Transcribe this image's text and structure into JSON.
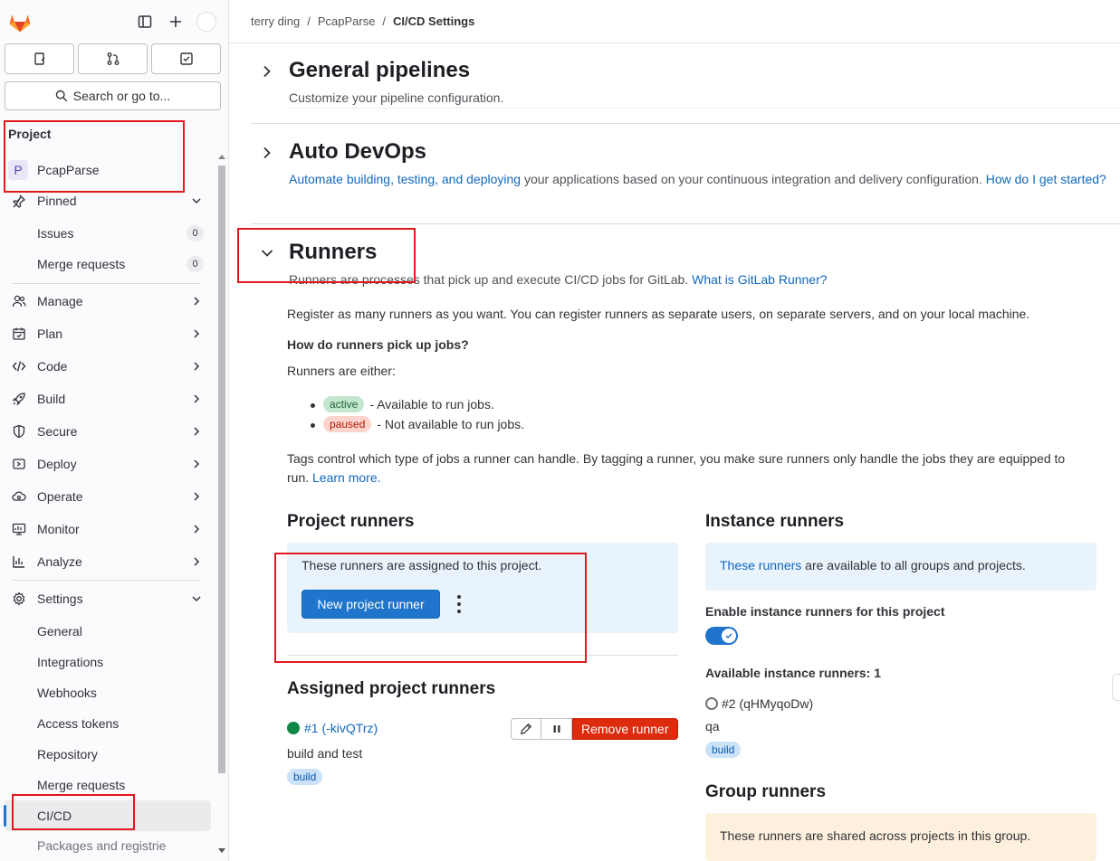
{
  "breadcrumb": {
    "items": [
      "terry ding",
      "PcapParse"
    ],
    "current": "CI/CD Settings"
  },
  "sidebar": {
    "search_label": "Search or go to...",
    "section_label": "Project",
    "project_initial": "P",
    "project_name": "PcapParse",
    "pinned_label": "Pinned",
    "pinned_items": [
      {
        "label": "Issues",
        "count": "0"
      },
      {
        "label": "Merge requests",
        "count": "0"
      }
    ],
    "nav": [
      "Manage",
      "Plan",
      "Code",
      "Build",
      "Secure",
      "Deploy",
      "Operate",
      "Monitor",
      "Analyze"
    ],
    "settings_label": "Settings",
    "settings_items": [
      "General",
      "Integrations",
      "Webhooks",
      "Access tokens",
      "Repository",
      "Merge requests",
      "CI/CD",
      "Packages and registrie"
    ]
  },
  "sections": {
    "general": {
      "title": "General pipelines",
      "desc": "Customize your pipeline configuration."
    },
    "autodevops": {
      "title": "Auto DevOps",
      "desc_link": "Automate building, testing, and deploying",
      "desc_text": " your applications based on your continuous integration and delivery configuration. ",
      "desc_link2": "How do I get started?"
    },
    "runners": {
      "title": "Runners",
      "desc_text": "Runners are processes that pick up and execute CI/CD jobs for GitLab. ",
      "desc_link": "What is GitLab Runner?",
      "register_text": "Register as many runners as you want. You can register runners as separate users, on separate servers, and on your local machine.",
      "how_heading": "How do runners pick up jobs?",
      "either_text": "Runners are either:",
      "active_pill": "active",
      "active_text": "- Available to run jobs.",
      "paused_pill": "paused",
      "paused_text": "- Not available to run jobs.",
      "tags_text": "Tags control which type of jobs a runner can handle. By tagging a runner, you make sure runners only handle the jobs they are equipped to run. ",
      "tags_link": "Learn more."
    }
  },
  "project_runners": {
    "title": "Project runners",
    "info": "These runners are assigned to this project.",
    "new_button": "New project runner",
    "assigned_title": "Assigned project runners",
    "runner": {
      "name": "#1 (-kivQTrz)",
      "description": "build and test",
      "tag": "build",
      "status_color": "#108548"
    },
    "remove_button": "Remove runner"
  },
  "instance_runners": {
    "title": "Instance runners",
    "info_link": "These runners",
    "info_text": " are available to all groups and projects.",
    "enable_label": "Enable instance runners for this project",
    "enabled": true,
    "available_label": "Available instance runners: 1",
    "runner": {
      "name": "#2 (qHMyqoDw)",
      "description": "qa",
      "tag": "build"
    }
  },
  "group_runners": {
    "title": "Group runners",
    "info": "These runners are shared across projects in this group."
  },
  "colors": {
    "accent": "#1f75cb",
    "danger": "#dd2b0e",
    "success": "#108548",
    "highlight": "#e0191e"
  }
}
